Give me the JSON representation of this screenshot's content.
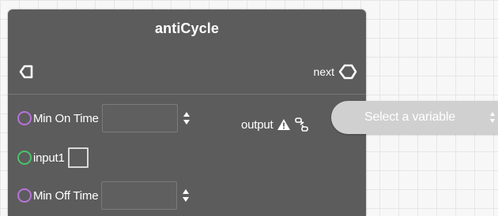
{
  "node": {
    "title": "antiCycle",
    "next_label": "next",
    "inputs": {
      "min_on_time": {
        "label": "Min On Time",
        "value": "",
        "placeholder": ""
      },
      "input1": {
        "label": "input1",
        "checked": false
      },
      "min_off_time": {
        "label": "Min Off Time",
        "value": "",
        "placeholder": ""
      }
    },
    "output": {
      "label": "output",
      "select_placeholder": "Select a variable"
    }
  },
  "icons": {
    "flow_in": "flow-in-port-icon",
    "flow_out": "flow-out-port-icon",
    "warning": "warning-triangle-icon",
    "link": "link-chain-icon"
  },
  "colors": {
    "node_bg": "#5c5c5c",
    "canvas_grid": "#e6e6e6",
    "numeric_port": "#b873d9",
    "boolean_port": "#49c26d",
    "variable_pill": "#d0d0d0"
  }
}
